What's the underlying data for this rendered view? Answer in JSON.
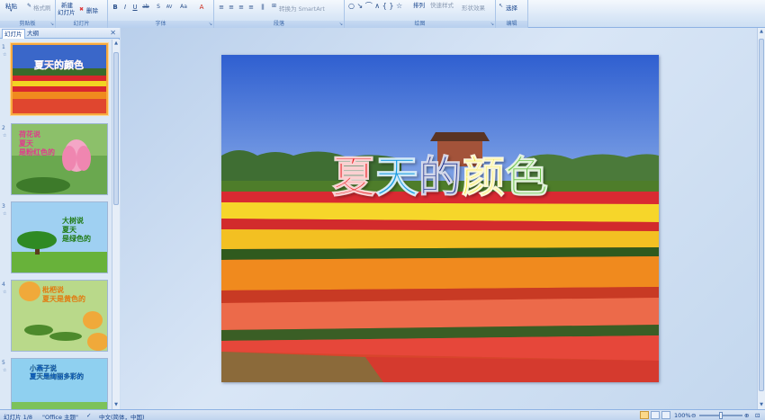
{
  "ribbon": {
    "clipboard": {
      "paste": "粘贴",
      "format_painter": "格式刷",
      "label": "剪贴板"
    },
    "slides": {
      "new_slide_line1": "新建",
      "new_slide_line2": "幻灯片",
      "delete": "删除",
      "label": "幻灯片"
    },
    "font": {
      "label": "字体"
    },
    "paragraph": {
      "smartart": "转换为 SmartArt",
      "label": "段落"
    },
    "drawing": {
      "arrange": "排列",
      "quick_styles": "快速样式",
      "shape_effects": "形状效果",
      "label": "绘图"
    },
    "editing": {
      "select": "选择",
      "label": "编辑"
    }
  },
  "pane": {
    "tab_slides": "幻灯片",
    "tab_outline": "大纲",
    "close": "✕",
    "thumbnails": [
      {
        "num": "1",
        "title": "夏天的颜色"
      },
      {
        "num": "2",
        "text": "荷花说\n夏天\n是粉红色的"
      },
      {
        "num": "3",
        "text": "大树说\n夏天\n是绿色的"
      },
      {
        "num": "4",
        "text": "枇杷说\n夏天是黄色的"
      },
      {
        "num": "5",
        "text": "小燕子说\n夏天是绚丽多彩的"
      }
    ]
  },
  "slide": {
    "title_chars": [
      "夏",
      "天",
      "的",
      "颜",
      "色"
    ],
    "title_colors": [
      "#e8171c",
      "#1a9be0",
      "#1b2f8c",
      "#f4e21a",
      "#6cc24a"
    ]
  },
  "status": {
    "slide_info": "幻灯片 1/8",
    "theme": "\"Office 主题\"",
    "language": "中文(简体，中国)",
    "zoom": "100%"
  },
  "colors": {
    "accent": "#f7a93e",
    "ribbon": "#dbe8f7",
    "text": "#15428b"
  }
}
